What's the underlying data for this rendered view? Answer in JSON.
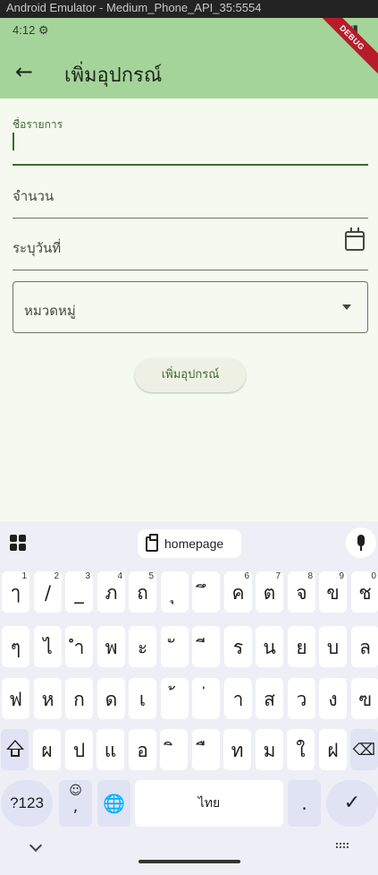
{
  "window": {
    "title": "Android Emulator - Medium_Phone_API_35:5554"
  },
  "status_bar": {
    "time": "4:12",
    "debug_banner": "DEBUG"
  },
  "app_bar": {
    "title": "เพิ่มอุปกรณ์"
  },
  "form": {
    "name_field": {
      "label": "ชื่อรายการ",
      "value": ""
    },
    "quantity_field": {
      "label": "จำนวน"
    },
    "date_field": {
      "label": "ระบุวันที่",
      "icon": "calendar-icon"
    },
    "category_dropdown": {
      "label": "หมวดหมู่"
    },
    "submit_label": "เพิ่มอุปกรณ์"
  },
  "keyboard": {
    "suggestion_chip": "homepage",
    "rows": [
      [
        {
          "ch": "ๅ",
          "hint": "1"
        },
        {
          "ch": "/",
          "hint": "2"
        },
        {
          "ch": "_",
          "hint": "3"
        },
        {
          "ch": "ภ",
          "hint": "4"
        },
        {
          "ch": "ถ",
          "hint": "5"
        },
        {
          "ch": "ุ",
          "hint": ""
        },
        {
          "ch": "ึ",
          "hint": ""
        },
        {
          "ch": "ค",
          "hint": "6"
        },
        {
          "ch": "ต",
          "hint": "7"
        },
        {
          "ch": "จ",
          "hint": "8"
        },
        {
          "ch": "ข",
          "hint": "9"
        },
        {
          "ch": "ช",
          "hint": "0"
        }
      ],
      [
        {
          "ch": "ๆ",
          "hint": ""
        },
        {
          "ch": "ไ",
          "hint": ""
        },
        {
          "ch": "ำ",
          "hint": ""
        },
        {
          "ch": "พ",
          "hint": ""
        },
        {
          "ch": "ะ",
          "hint": ""
        },
        {
          "ch": "ั",
          "hint": ""
        },
        {
          "ch": "ี",
          "hint": ""
        },
        {
          "ch": "ร",
          "hint": ""
        },
        {
          "ch": "น",
          "hint": ""
        },
        {
          "ch": "ย",
          "hint": ""
        },
        {
          "ch": "บ",
          "hint": ""
        },
        {
          "ch": "ล",
          "hint": ""
        }
      ],
      [
        {
          "ch": "ฟ",
          "hint": ""
        },
        {
          "ch": "ห",
          "hint": ""
        },
        {
          "ch": "ก",
          "hint": ""
        },
        {
          "ch": "ด",
          "hint": ""
        },
        {
          "ch": "เ",
          "hint": ""
        },
        {
          "ch": "้",
          "hint": ""
        },
        {
          "ch": "่",
          "hint": ""
        },
        {
          "ch": "า",
          "hint": ""
        },
        {
          "ch": "ส",
          "hint": ""
        },
        {
          "ch": "ว",
          "hint": ""
        },
        {
          "ch": "ง",
          "hint": ""
        },
        {
          "ch": "ฃ",
          "hint": ""
        }
      ],
      [
        {
          "ch": "ผ",
          "hint": ""
        },
        {
          "ch": "ป",
          "hint": ""
        },
        {
          "ch": "แ",
          "hint": ""
        },
        {
          "ch": "อ",
          "hint": ""
        },
        {
          "ch": "ิ",
          "hint": ""
        },
        {
          "ch": "ื",
          "hint": ""
        },
        {
          "ch": "ท",
          "hint": ""
        },
        {
          "ch": "ม",
          "hint": ""
        },
        {
          "ch": "ใ",
          "hint": ""
        },
        {
          "ch": "ฝ",
          "hint": ""
        }
      ]
    ],
    "symbols_key": "?123",
    "emoji_key_top": "☺",
    "emoji_key_bottom": ",",
    "globe_key": "🌐",
    "space_key": "ไทย",
    "period_key": ".",
    "enter_key": "✓",
    "backspace_key": "⌫"
  }
}
